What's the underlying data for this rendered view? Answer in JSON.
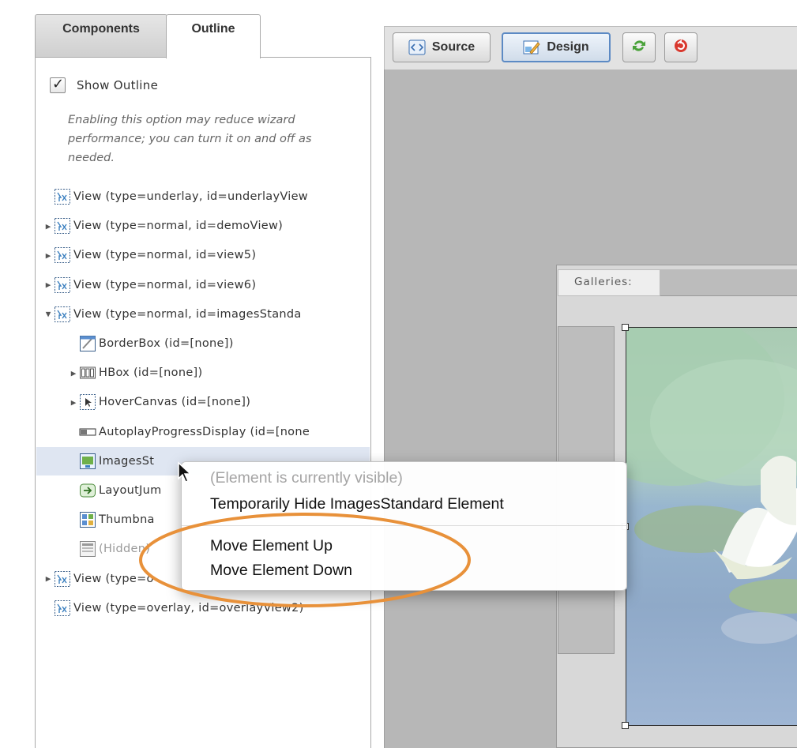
{
  "tabs": {
    "components": "Components",
    "outline": "Outline"
  },
  "show_outline": {
    "label": "Show Outline",
    "checked": true,
    "check_glyph": "✓"
  },
  "warning": "Enabling this option may reduce wizard performance; you can turn it on and off as needed.",
  "tree": [
    {
      "label": "View (type=underlay, id=underlayView",
      "icon": "view-icon",
      "expandable": false,
      "expanded": false,
      "indent": 0
    },
    {
      "label": "View (type=normal, id=demoView)",
      "icon": "view-icon",
      "expandable": true,
      "expanded": false,
      "indent": 0
    },
    {
      "label": "View (type=normal, id=view5)",
      "icon": "view-icon",
      "expandable": true,
      "expanded": false,
      "indent": 0
    },
    {
      "label": "View (type=normal, id=view6)",
      "icon": "view-icon",
      "expandable": true,
      "expanded": false,
      "indent": 0
    },
    {
      "label": "View (type=normal, id=imagesStanda",
      "icon": "view-icon",
      "expandable": true,
      "expanded": true,
      "indent": 0
    },
    {
      "label": "BorderBox (id=[none])",
      "icon": "borderbox-icon",
      "expandable": false,
      "expanded": false,
      "indent": 1
    },
    {
      "label": "HBox (id=[none])",
      "icon": "hbox-icon",
      "expandable": true,
      "expanded": false,
      "indent": 1
    },
    {
      "label": "HoverCanvas (id=[none])",
      "icon": "hovercanvas-icon",
      "expandable": true,
      "expanded": false,
      "indent": 1
    },
    {
      "label": "AutoplayProgressDisplay (id=[none",
      "icon": "progress-display-icon",
      "expandable": false,
      "expanded": false,
      "indent": 1
    },
    {
      "label": "ImagesSt",
      "icon": "images-icon",
      "expandable": false,
      "expanded": false,
      "indent": 1,
      "selected": true
    },
    {
      "label": "LayoutJum",
      "icon": "layout-jump-icon",
      "expandable": false,
      "expanded": false,
      "indent": 1
    },
    {
      "label": "Thumbna",
      "icon": "thumbnail-icon",
      "expandable": false,
      "expanded": false,
      "indent": 1
    },
    {
      "label": "(Hidden)",
      "icon": "hidden-element-icon",
      "expandable": false,
      "expanded": false,
      "indent": 1,
      "hidden": true
    },
    {
      "label": "View (type=o",
      "icon": "view-icon",
      "expandable": true,
      "expanded": false,
      "indent": 0
    },
    {
      "label": "View (type=overlay, id=overlayView2)",
      "icon": "view-icon",
      "expandable": false,
      "expanded": false,
      "indent": 0
    }
  ],
  "toolbar": {
    "source": "Source",
    "design": "Design",
    "source_icon": "code-icon",
    "design_icon": "design-icon",
    "refresh_icon": "refresh-icon",
    "revert_icon": "revert-icon"
  },
  "gallery": {
    "tab_label": "Galleries:"
  },
  "context_menu": {
    "status": "(Element is currently visible)",
    "hide": "Temporarily Hide ImagesStandard Element",
    "move_up": "Move Element Up",
    "move_down": "Move Element Down"
  },
  "colors": {
    "highlight_ellipse": "#e8913a",
    "selected_row": "#dfe6f2",
    "design_button_border": "#5c8ac4"
  }
}
